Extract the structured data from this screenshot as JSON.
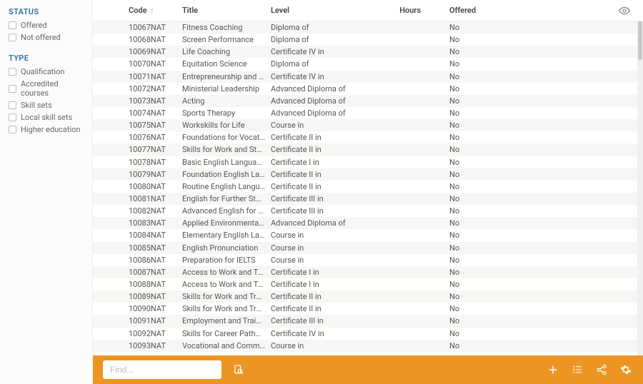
{
  "filters": {
    "status": {
      "heading": "STATUS",
      "items": [
        "Offered",
        "Not offered"
      ]
    },
    "type": {
      "heading": "TYPE",
      "items": [
        "Qualification",
        "Accredited courses",
        "Skill sets",
        "Local skill sets",
        "Higher education"
      ]
    }
  },
  "columns": {
    "code": "Code",
    "title": "Title",
    "level": "Level",
    "hours": "Hours",
    "offered": "Offered"
  },
  "rows": [
    {
      "code": "10067NAT",
      "title": "Fitness Coaching",
      "level": "Diploma of",
      "hours": "",
      "offered": "No"
    },
    {
      "code": "10068NAT",
      "title": "Screen Performance",
      "level": "Diploma of",
      "hours": "",
      "offered": "No"
    },
    {
      "code": "10069NAT",
      "title": "Life Coaching",
      "level": "Certificate IV in",
      "hours": "",
      "offered": "No"
    },
    {
      "code": "10070NAT",
      "title": "Equitation Science",
      "level": "Diploma of",
      "hours": "",
      "offered": "No"
    },
    {
      "code": "10071NAT",
      "title": "Entrepreneurship and New...",
      "level": "Certificate IV in",
      "hours": "",
      "offered": "No"
    },
    {
      "code": "10072NAT",
      "title": "Ministerial Leadership",
      "level": "Advanced Diploma of",
      "hours": "",
      "offered": "No"
    },
    {
      "code": "10073NAT",
      "title": "Acting",
      "level": "Advanced Diploma of",
      "hours": "",
      "offered": "No"
    },
    {
      "code": "10074NAT",
      "title": "Sports Therapy",
      "level": "Advanced Diploma of",
      "hours": "",
      "offered": "No"
    },
    {
      "code": "10075NAT",
      "title": "Workskills for Life",
      "level": "Course in",
      "hours": "",
      "offered": "No"
    },
    {
      "code": "10076NAT",
      "title": "Foundations for Vocational...",
      "level": "Certificate II in",
      "hours": "",
      "offered": "No"
    },
    {
      "code": "10077NAT",
      "title": "Skills for Work and Study",
      "level": "Certificate II in",
      "hours": "",
      "offered": "No"
    },
    {
      "code": "10078NAT",
      "title": "Basic English Language Sk...",
      "level": "Certificate I in",
      "hours": "",
      "offered": "No"
    },
    {
      "code": "10079NAT",
      "title": "Foundation English Langua...",
      "level": "Certificate II in",
      "hours": "",
      "offered": "No"
    },
    {
      "code": "10080NAT",
      "title": "Routine English Language ...",
      "level": "Certificate II in",
      "hours": "",
      "offered": "No"
    },
    {
      "code": "10081NAT",
      "title": "English for Further Study",
      "level": "Certificate III in",
      "hours": "",
      "offered": "No"
    },
    {
      "code": "10082NAT",
      "title": "Advanced English for Furth...",
      "level": "Certificate III in",
      "hours": "",
      "offered": "No"
    },
    {
      "code": "10083NAT",
      "title": "Applied Environmental Ma...",
      "level": "Advanced Diploma of",
      "hours": "",
      "offered": "No"
    },
    {
      "code": "10084NAT",
      "title": "Elementary English Langua...",
      "level": "Course in",
      "hours": "",
      "offered": "No"
    },
    {
      "code": "10085NAT",
      "title": "English Pronunciation",
      "level": "Course in",
      "hours": "",
      "offered": "No"
    },
    {
      "code": "10086NAT",
      "title": "Preparation for IELTS",
      "level": "Course in",
      "hours": "",
      "offered": "No"
    },
    {
      "code": "10087NAT",
      "title": "Access to Work and Traini...",
      "level": "Certificate I in",
      "hours": "",
      "offered": "No"
    },
    {
      "code": "10088NAT",
      "title": "Access to Work and Training",
      "level": "Certificate I in",
      "hours": "",
      "offered": "No"
    },
    {
      "code": "10089NAT",
      "title": "Skills for Work and Training",
      "level": "Certificate II in",
      "hours": "",
      "offered": "No"
    },
    {
      "code": "10090NAT",
      "title": "Skills for Work and Trainin...",
      "level": "Certificate II in",
      "hours": "",
      "offered": "No"
    },
    {
      "code": "10091NAT",
      "title": "Employment and Training",
      "level": "Certificate III in",
      "hours": "",
      "offered": "No"
    },
    {
      "code": "10092NAT",
      "title": "Skills for Career Pathways",
      "level": "Certificate IV in",
      "hours": "",
      "offered": "No"
    },
    {
      "code": "10093NAT",
      "title": "Vocational and Community...",
      "level": "Course in",
      "hours": "",
      "offered": "No"
    }
  ],
  "bottombar": {
    "find_placeholder": "Find..."
  }
}
